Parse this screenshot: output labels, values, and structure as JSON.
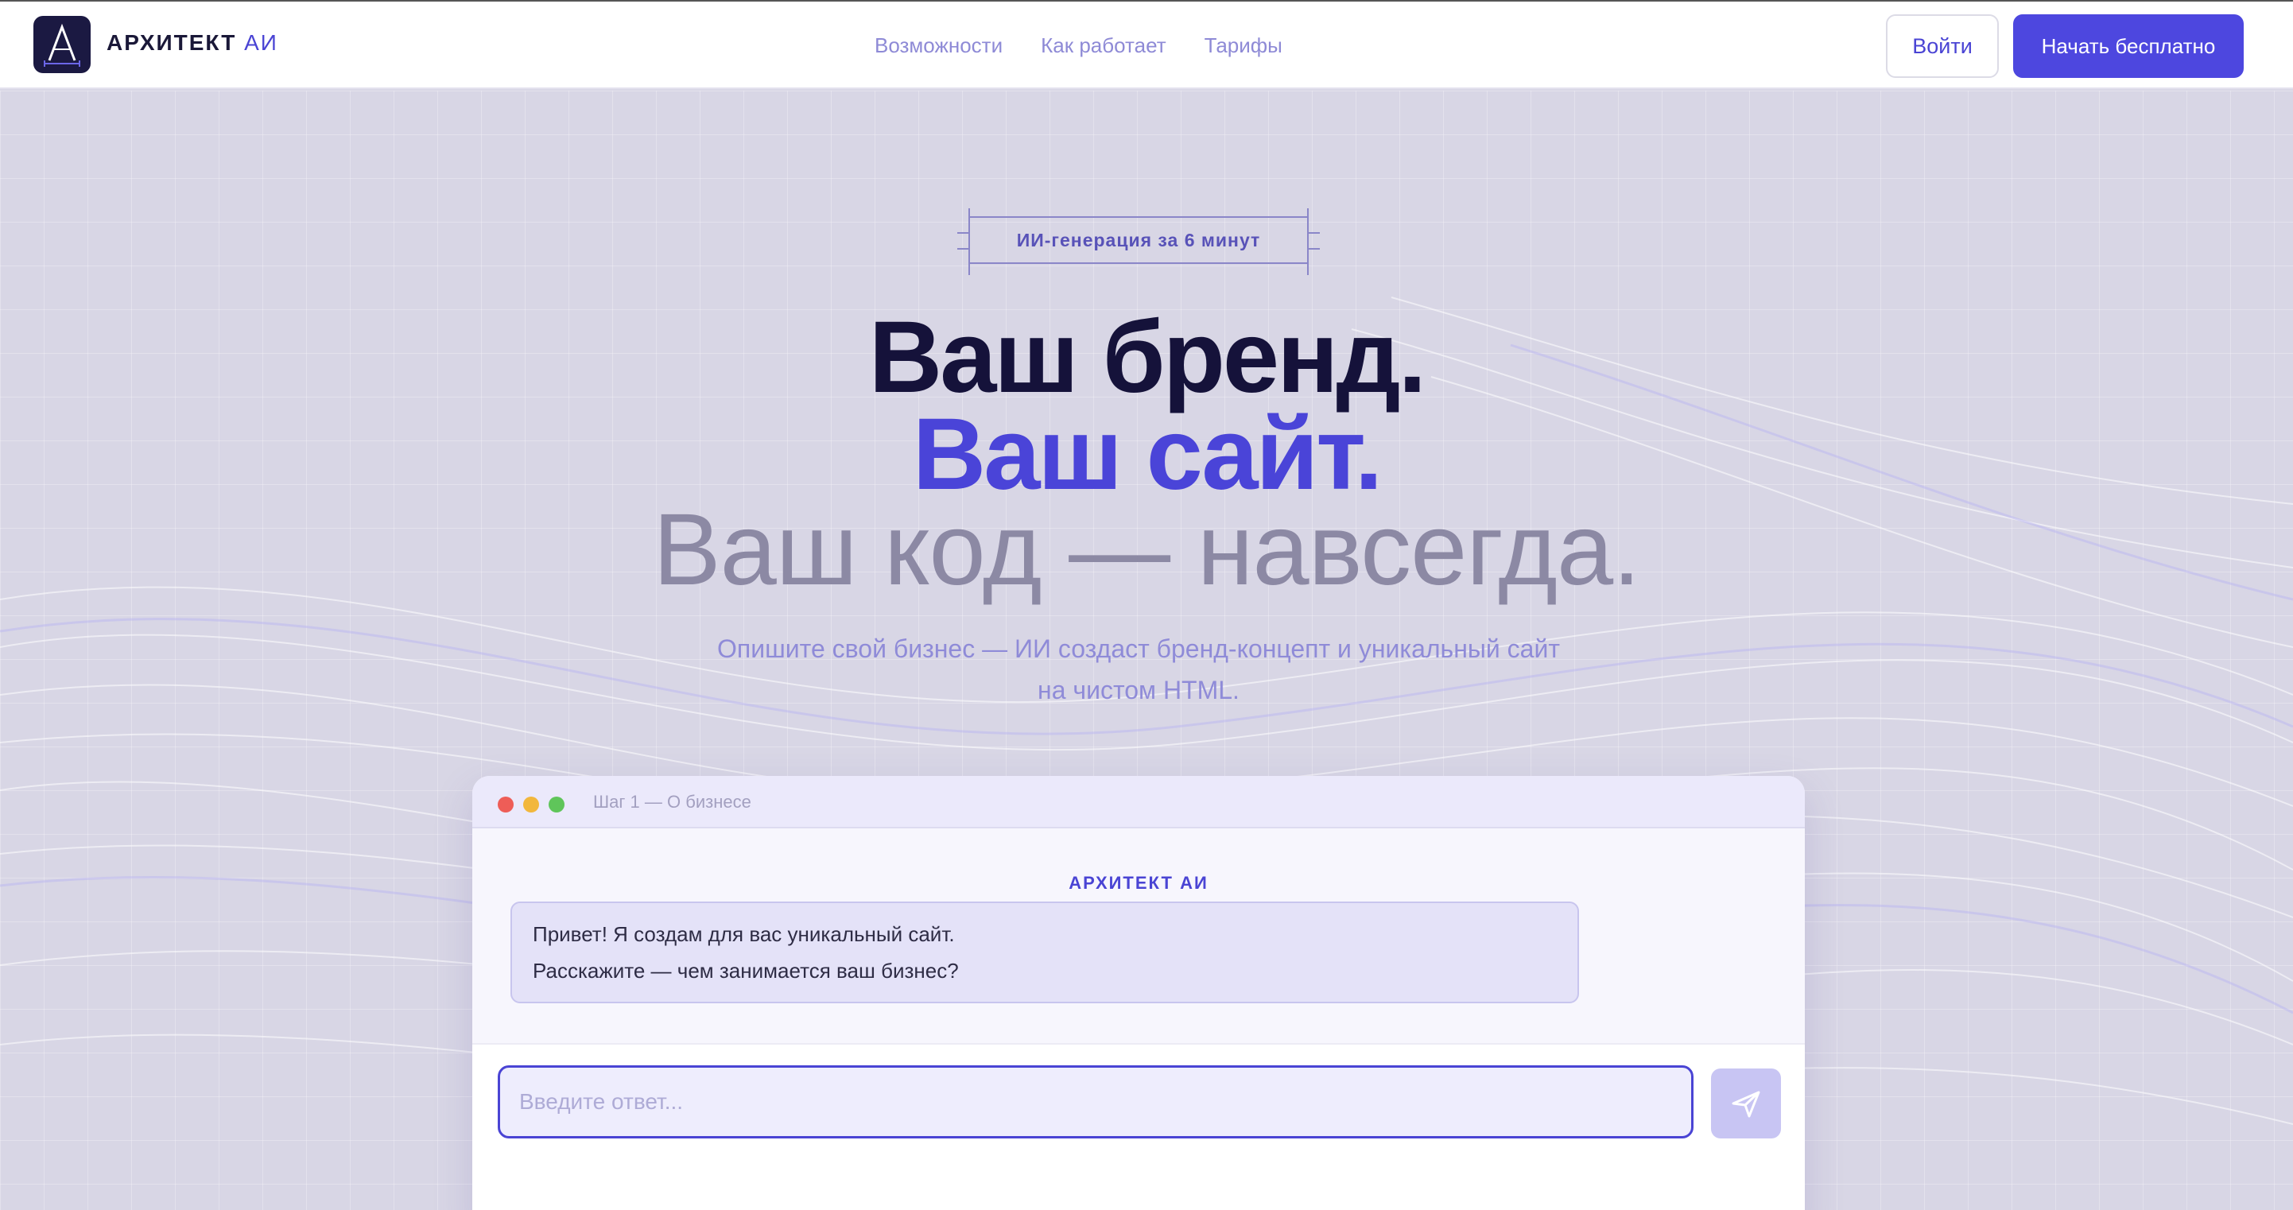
{
  "header": {
    "brand_name": "АРХИТЕКТ",
    "brand_accent": "АИ",
    "logo_letter": "A",
    "nav": [
      {
        "label": "Возможности"
      },
      {
        "label": "Как работает"
      },
      {
        "label": "Тарифы"
      }
    ],
    "login_label": "Войти",
    "start_label": "Начать бесплатно"
  },
  "hero": {
    "badge": "ИИ-генерация за 6 минут",
    "headline_1": "Ваш бренд.",
    "headline_2": "Ваш сайт.",
    "headline_3": "Ваш код — навсегда.",
    "subtitle": "Опишите свой бизнес — ИИ создаст бренд-концепт и уникальный сайт на чистом HTML."
  },
  "chat": {
    "step_label": "Шаг 1 — О бизнесе",
    "sender": "АРХИТЕКТ АИ",
    "messages": [
      "Привет! Я создам для вас уникальный сайт.",
      "Расскажите — чем занимается ваш бизнес?"
    ],
    "input_placeholder": "Введите ответ...",
    "input_value": "",
    "send_icon": "send-icon"
  },
  "colors": {
    "accent": "#4d47df",
    "dark": "#15123a",
    "muted": "#8c89a4"
  }
}
